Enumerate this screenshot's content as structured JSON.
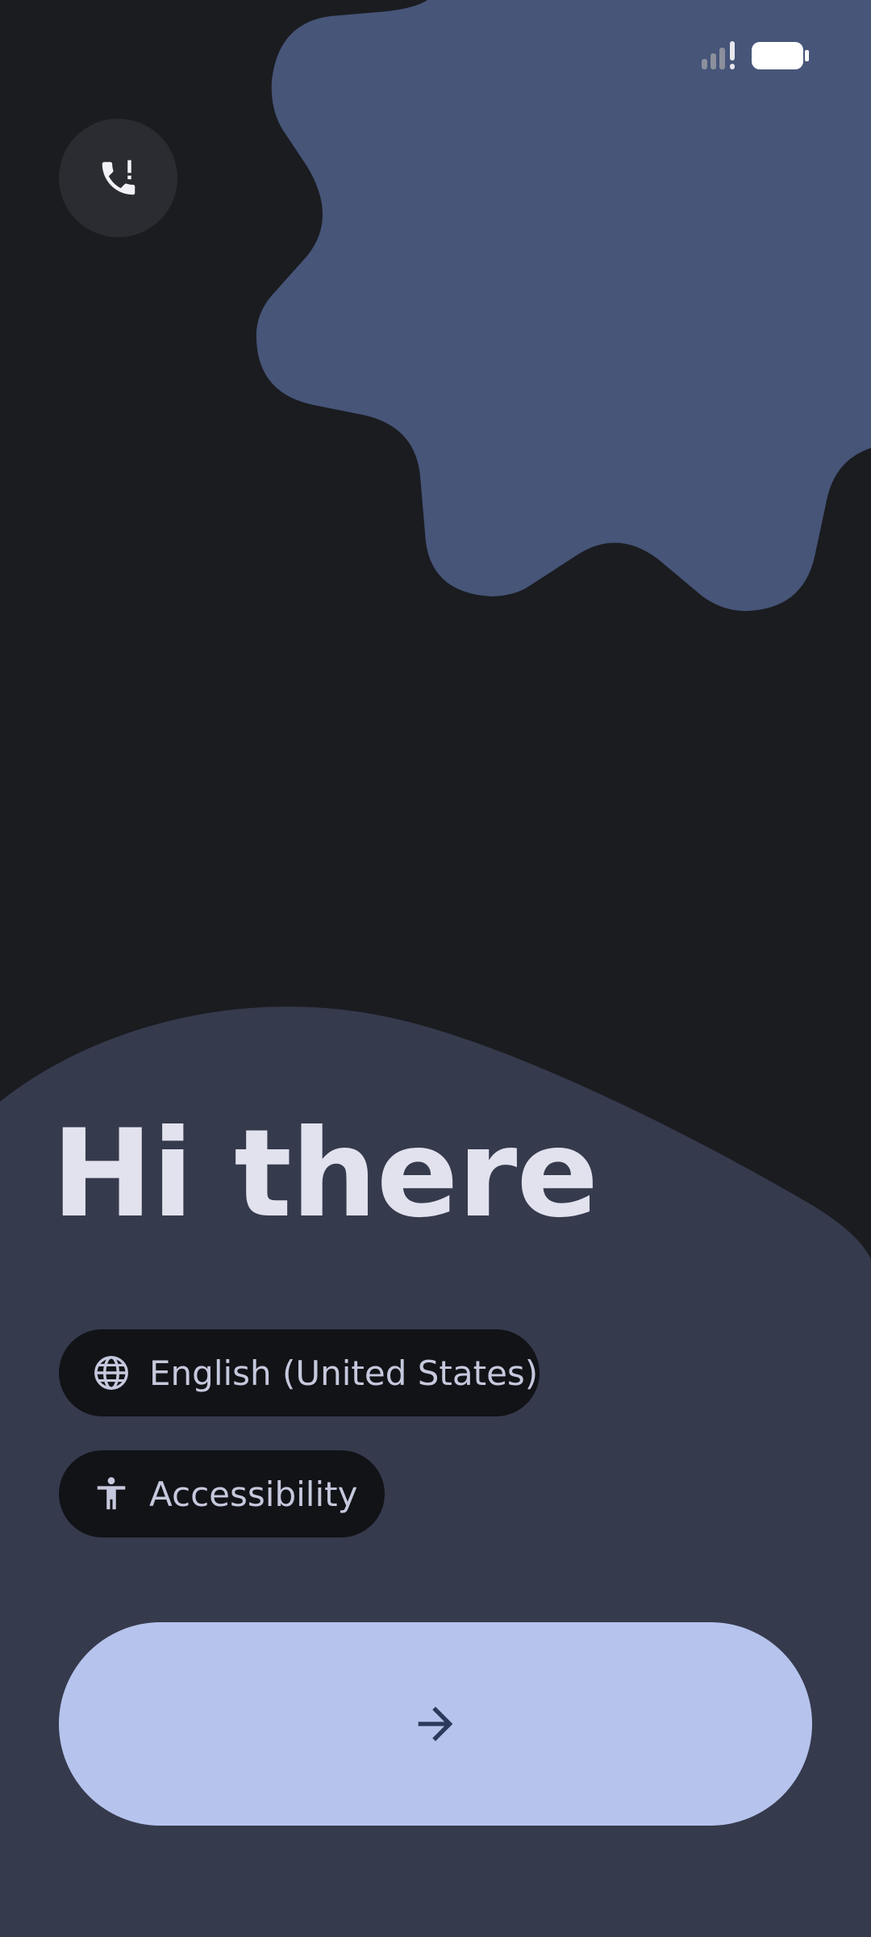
{
  "colors": {
    "background": "#1b1c20",
    "accent_shape": "#465578",
    "wave": "#363a4d",
    "chip_background": "#121317",
    "chip_text": "#c6c9dd",
    "primary_button": "#b6c4ed",
    "primary_button_icon": "#2b3a5c",
    "headline": "#e2e2ee"
  },
  "status_bar": {
    "icons": [
      "signal-icon",
      "battery-icon"
    ]
  },
  "emergency": {
    "icon": "phone-alert-icon"
  },
  "welcome": {
    "title": "Hi there"
  },
  "language_chip": {
    "icon": "globe-icon",
    "label": "English (United States)"
  },
  "accessibility_chip": {
    "icon": "accessibility-icon",
    "label": "Accessibility"
  },
  "start_button": {
    "icon": "arrow-right-icon"
  }
}
